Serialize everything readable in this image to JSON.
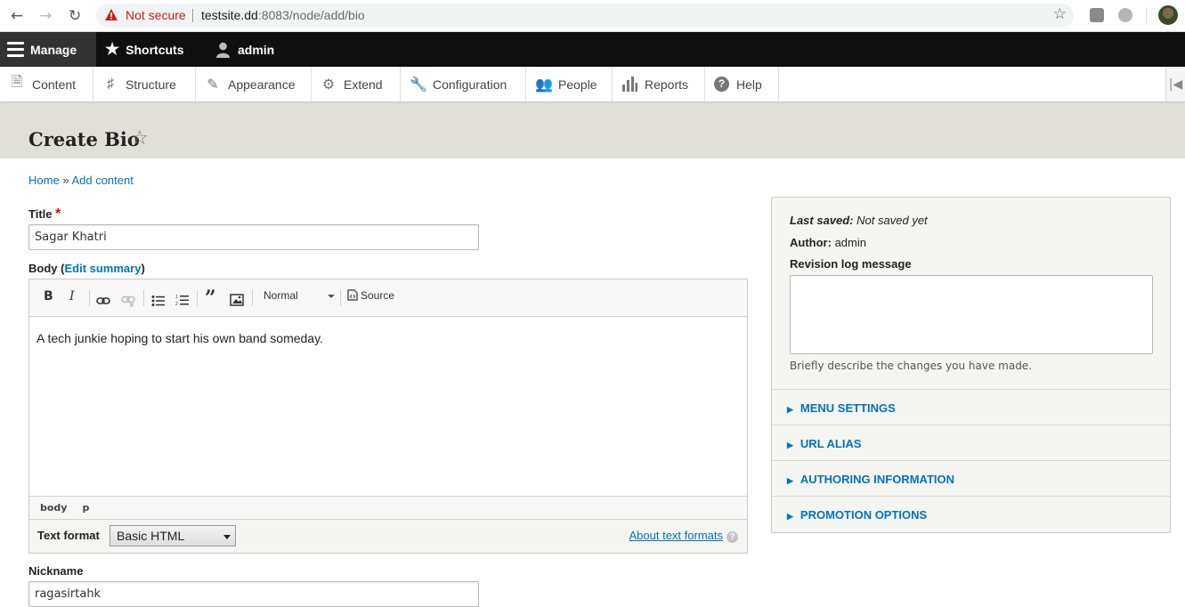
{
  "browser": {
    "security_label": "Not secure",
    "url_host": "testsite.dd",
    "url_rest": ":8083/node/add/bio"
  },
  "toolbar": {
    "manage": "Manage",
    "shortcuts": "Shortcuts",
    "user": "admin"
  },
  "admin_menu": [
    {
      "label": "Content",
      "icon": "file-icon"
    },
    {
      "label": "Structure",
      "icon": "sitemap-icon"
    },
    {
      "label": "Appearance",
      "icon": "paintbrush-icon"
    },
    {
      "label": "Extend",
      "icon": "puzzle-icon"
    },
    {
      "label": "Configuration",
      "icon": "wrench-icon"
    },
    {
      "label": "People",
      "icon": "people-icon"
    },
    {
      "label": "Reports",
      "icon": "chart-icon"
    },
    {
      "label": "Help",
      "icon": "question-icon"
    }
  ],
  "page": {
    "title": "Create Bio"
  },
  "breadcrumb": {
    "home": "Home",
    "separator": "»",
    "add_content": "Add content"
  },
  "form": {
    "title_label": "Title",
    "title_required": "*",
    "title_value": "Sagar Khatri",
    "body_label": "Body",
    "body_paren_open": "(",
    "edit_summary": "Edit summary",
    "body_paren_close": ")",
    "format_combo": "Normal",
    "source_label": "Source",
    "body_text": "A tech junkie hoping to start his own band someday.",
    "path_body": "body",
    "path_p": "p",
    "text_format_label": "Text format",
    "text_format_value": "Basic HTML",
    "about_text_formats": "About text formats",
    "nickname_label": "Nickname",
    "nickname_value": "ragasirtahk"
  },
  "sidebar": {
    "last_saved_label": "Last saved:",
    "last_saved_value": "Not saved yet",
    "author_label": "Author:",
    "author_value": "admin",
    "revision_label": "Revision log message",
    "revision_desc": "Briefly describe the changes you have made.",
    "sections": [
      "MENU SETTINGS",
      "URL ALIAS",
      "AUTHORING INFORMATION",
      "PROMOTION OPTIONS"
    ]
  },
  "colors": {
    "link": "#0074bd",
    "toolbar_bg": "#0f0f0f",
    "header_band": "#e0e0d8",
    "required": "#e00000"
  }
}
